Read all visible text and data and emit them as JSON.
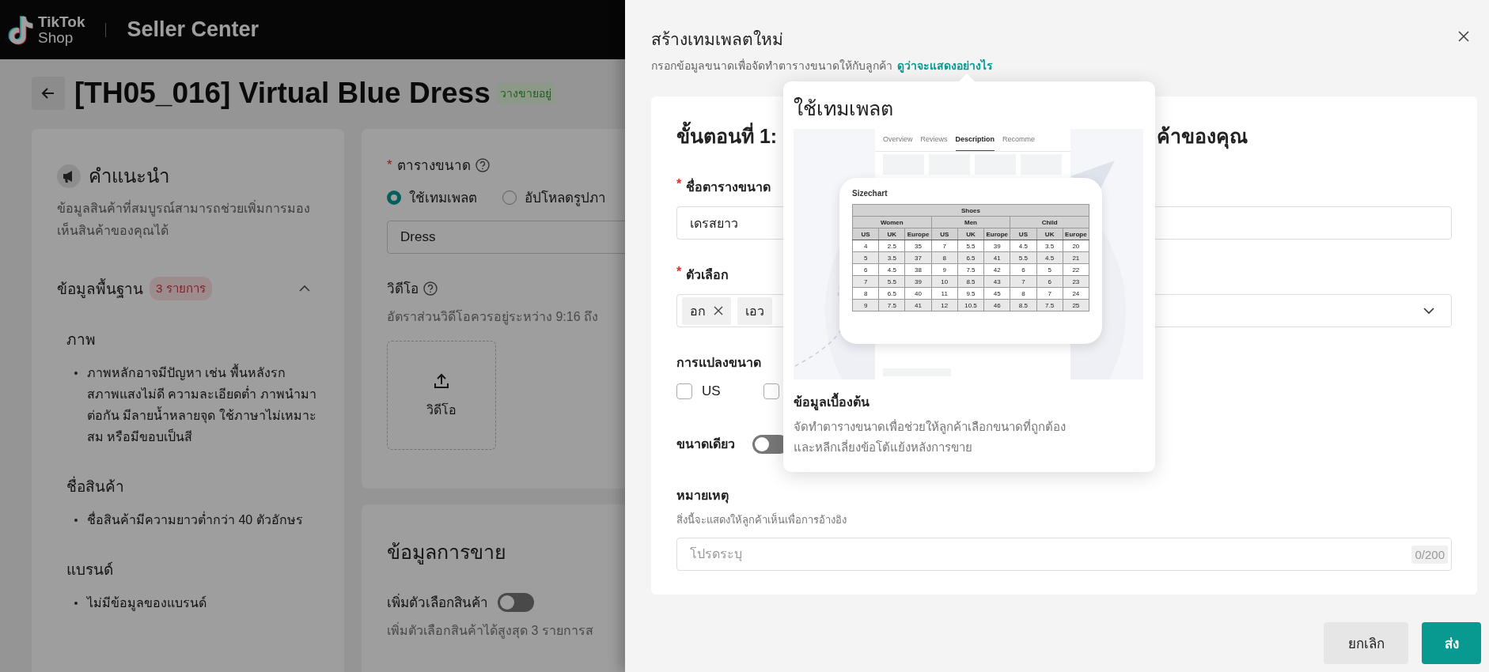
{
  "header": {
    "logo_top": "TikTok",
    "logo_bottom": "Shop",
    "product": "Seller Center"
  },
  "page": {
    "title": "[TH05_016] Virtual Blue Dress",
    "status": "วางขายอยู่"
  },
  "tips": {
    "title": "คำแนะนำ",
    "description": "ข้อมูลสินค้าที่สมบูรณ์สามารถช่วยเพิ่มการมองเห็นสินค้าของคุณได้",
    "section": {
      "title": "ข้อมูลพื้นฐาน",
      "count": "3 รายการ",
      "expanded": true
    },
    "groups": [
      {
        "title": "ภาพ",
        "items": [
          "ภาพหลักอาจมีปัญหา เช่น พื้นหลังรก สภาพแสงไม่ดี ความละเอียดต่ำ ภาพนำมาต่อกัน มีลายน้ำหลายจุด ใช้ภาษาไม่เหมาะสม หรือมีขอบเป็นสี"
        ]
      },
      {
        "title": "ชื่อสินค้า",
        "items": [
          "ชื่อสินค้ามีความยาวต่ำกว่า 40 ตัวอักษร"
        ]
      },
      {
        "title": "แบรนด์",
        "items": [
          "ไม่มีข้อมูลของแบรนด์"
        ]
      }
    ]
  },
  "form": {
    "size_chart": {
      "marker": "*",
      "label": "ตารางขนาด",
      "options": [
        {
          "label": "ใช้เทมเพลต",
          "selected": true
        },
        {
          "label": "อัปโหลดรูปภา",
          "selected": false
        }
      ],
      "value": "Dress"
    },
    "video": {
      "label": "วิดีโอ",
      "hint": "อัตราส่วนวิดีโอควรอยู่ระหว่าง 9:16 ถึง",
      "upload": "วิดีโอ"
    },
    "sales": {
      "title": "ข้อมูลการขาย",
      "variants_label": "เพิ่มตัวเลือกสินค้า",
      "variants_on": false,
      "variants_hint": "เพิ่มตัวเลือกสินค้าได้สูงสุด 3 รายการส"
    }
  },
  "drawer": {
    "title": "สร้างเทมเพลตใหม่",
    "subtitle": "กรอกข้อมูลขนาดเพื่อจัดทำตารางขนาดให้กับลูกค้า",
    "link": "ดูว่าจะแสดงอย่างไร",
    "step_start": "ขั้นตอนที่ 1:",
    "step_end": "ค้าของคุณ",
    "name_field": {
      "marker": "*",
      "label": "ชื่อตารางขนาด",
      "value": "เดรสยาว"
    },
    "options_field": {
      "marker": "*",
      "label": "ตัวเลือก",
      "tags": [
        "อก",
        "เอว"
      ]
    },
    "conversion": {
      "label": "การแปลงขนาด",
      "options": [
        {
          "label": "US",
          "checked": false
        },
        {
          "checked": false
        }
      ]
    },
    "single_size": {
      "label": "ขนาดเดียว",
      "on": false
    },
    "note": {
      "label": "หมายเหตุ",
      "hint": "สิ่งนี้จะแสดงให้ลูกค้าเห็นเพื่อการอ้างอิง",
      "placeholder": "โปรดระบุ",
      "counter": "0/200"
    },
    "buttons": {
      "cancel": "ยกเลิก",
      "submit": "ส่ง"
    }
  },
  "popover": {
    "title": "ใช้เทมเพลต",
    "info_title": "ข้อมูลเบื้องต้น",
    "info_text": "จัดทำตารางขนาดเพื่อช่วยให้ลูกค้าเลือกขนาดที่ถูกต้องและหลีกเลี่ยงข้อโต้แย้งหลังการขาย",
    "preview": {
      "tabs": [
        {
          "label": "Overview",
          "selected": false
        },
        {
          "label": "Reviews",
          "selected": false
        },
        {
          "label": "Description",
          "selected": true
        },
        {
          "label": "Recomme",
          "selected": false
        }
      ],
      "card_title": "Sizechart",
      "table_title": "Shoes",
      "groups": [
        "Women",
        "Men",
        "Child"
      ],
      "columns": [
        "US",
        "UK",
        "Europe",
        "US",
        "UK",
        "Europe",
        "US",
        "UK",
        "Europe"
      ],
      "rows": [
        [
          "4",
          "2.5",
          "35",
          "7",
          "5.5",
          "39",
          "4.5",
          "3.5",
          "20"
        ],
        [
          "5",
          "3.5",
          "37",
          "8",
          "6.5",
          "41",
          "5.5",
          "4.5",
          "21"
        ],
        [
          "6",
          "4.5",
          "38",
          "9",
          "7.5",
          "42",
          "6",
          "5",
          "22"
        ],
        [
          "7",
          "5.5",
          "39",
          "10",
          "8.5",
          "43",
          "7",
          "6",
          "23"
        ],
        [
          "8",
          "6.5",
          "40",
          "11",
          "9.5",
          "45",
          "8",
          "7",
          "24"
        ],
        [
          "9",
          "7.5",
          "41",
          "12",
          "10.5",
          "46",
          "8.5",
          "7.5",
          "25"
        ]
      ]
    }
  }
}
